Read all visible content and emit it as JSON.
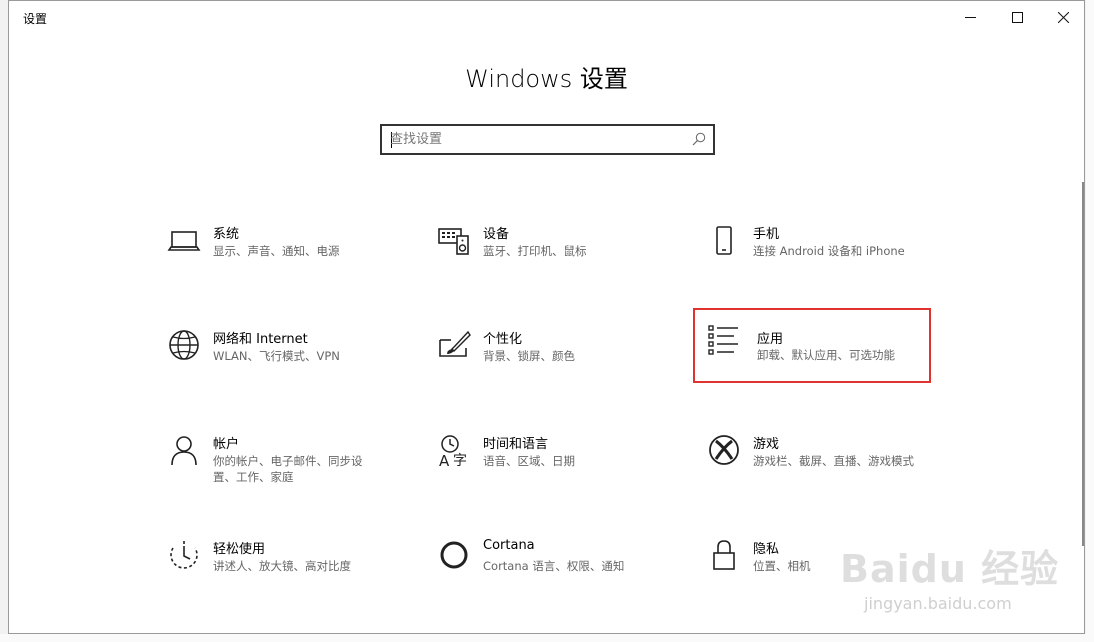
{
  "window": {
    "title": "设置",
    "controls": {
      "minimize": "minimize-icon",
      "maximize": "maximize-icon",
      "close": "close-icon"
    }
  },
  "header": {
    "title": "Windows 设置"
  },
  "search": {
    "placeholder": "查找设置",
    "value": ""
  },
  "tiles": [
    {
      "id": "system",
      "label": "系统",
      "desc": "显示、声音、通知、电源",
      "icon": "laptop-icon"
    },
    {
      "id": "devices",
      "label": "设备",
      "desc": "蓝牙、打印机、鼠标",
      "icon": "devices-icon"
    },
    {
      "id": "phone",
      "label": "手机",
      "desc": "连接 Android 设备和 iPhone",
      "icon": "phone-icon"
    },
    {
      "id": "network",
      "label": "网络和 Internet",
      "desc": "WLAN、飞行模式、VPN",
      "icon": "globe-icon"
    },
    {
      "id": "personalization",
      "label": "个性化",
      "desc": "背景、锁屏、颜色",
      "icon": "paint-brush-icon"
    },
    {
      "id": "apps",
      "label": "应用",
      "desc": "卸载、默认应用、可选功能",
      "icon": "apps-list-icon",
      "highlighted": true
    },
    {
      "id": "accounts",
      "label": "帐户",
      "desc": "你的帐户、电子邮件、同步设置、工作、家庭",
      "icon": "person-icon"
    },
    {
      "id": "time-language",
      "label": "时间和语言",
      "desc": "语音、区域、日期",
      "icon": "time-language-icon"
    },
    {
      "id": "gaming",
      "label": "游戏",
      "desc": "游戏栏、截屏、直播、游戏模式",
      "icon": "xbox-icon"
    },
    {
      "id": "ease-of-access",
      "label": "轻松使用",
      "desc": "讲述人、放大镜、高对比度",
      "icon": "ease-of-access-icon"
    },
    {
      "id": "cortana",
      "label": "Cortana",
      "desc": "Cortana 语言、权限、通知",
      "icon": "cortana-icon"
    },
    {
      "id": "privacy",
      "label": "隐私",
      "desc": "位置、相机",
      "icon": "lock-icon"
    }
  ],
  "colors": {
    "highlight": "#e0322f",
    "text": "#000000",
    "subtext": "#666666"
  },
  "watermark": {
    "main": "Baidu 经验",
    "sub": "jingyan.baidu.com"
  }
}
